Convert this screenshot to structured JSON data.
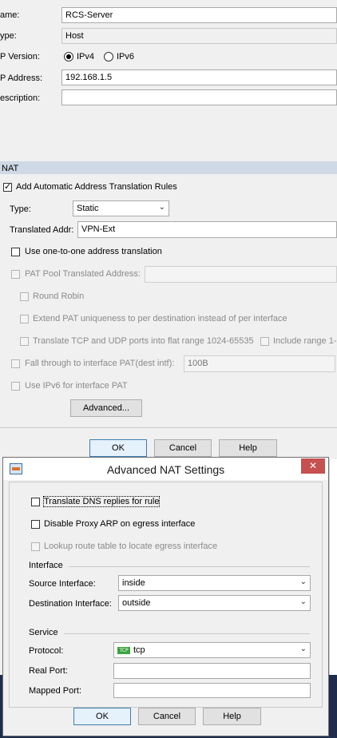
{
  "form": {
    "name_label": "ame:",
    "name_value": "RCS-Server",
    "type_label": "ype:",
    "type_value": "Host",
    "ip_version_label": "P Version:",
    "ipv4_label": "IPv4",
    "ipv6_label": "IPv6",
    "ip_version_selected": "IPv4",
    "ip_address_label": "P Address:",
    "ip_address_value": "192.168.1.5",
    "description_label": "escription:",
    "description_value": ""
  },
  "nat": {
    "section_title": "NAT",
    "auto_rules_label": "Add Automatic Address Translation Rules",
    "auto_rules_checked": true,
    "type_label": "Type:",
    "type_value": "Static",
    "translated_addr_label": "Translated Addr:",
    "translated_addr_value": "VPN-Ext",
    "one_to_one_label": "Use one-to-one address translation",
    "pat_pool_label": "PAT Pool Translated Address:",
    "round_robin_label": "Round Robin",
    "extend_pat_label": "Extend PAT uniqueness to per destination instead of per interface",
    "translate_tcp_udp_label": "Translate TCP and UDP ports into flat range 1024-65535",
    "include_range_label": "Include range 1-",
    "fall_through_label": "Fall through to interface PAT(dest intf):",
    "fall_through_value": "100B",
    "use_ipv6_label": "Use IPv6 for interface PAT",
    "advanced_button": "Advanced..."
  },
  "main_buttons": {
    "ok": "OK",
    "cancel": "Cancel",
    "help": "Help"
  },
  "dialog": {
    "title": "Advanced NAT Settings",
    "close_glyph": "✕",
    "translate_dns_label": "Translate DNS replies for rule",
    "disable_proxy_arp_label": "Disable Proxy ARP on egress interface",
    "lookup_route_label": "Lookup route table to locate egress interface",
    "interface_group": "Interface",
    "source_interface_label": "Source Interface:",
    "source_interface_value": "inside",
    "destination_interface_label": "Destination Interface:",
    "destination_interface_value": "outside",
    "service_group": "Service",
    "protocol_label": "Protocol:",
    "protocol_icon_text": "TCP",
    "protocol_value": "tcp",
    "real_port_label": "Real Port:",
    "real_port_value": "",
    "mapped_port_label": "Mapped Port:",
    "mapped_port_value": "",
    "ok": "OK",
    "cancel": "Cancel",
    "help": "Help"
  },
  "colors": {
    "section_bar": "#cfd9e5",
    "close_button": "#c75050",
    "default_button_border": "#3c7fb1"
  }
}
